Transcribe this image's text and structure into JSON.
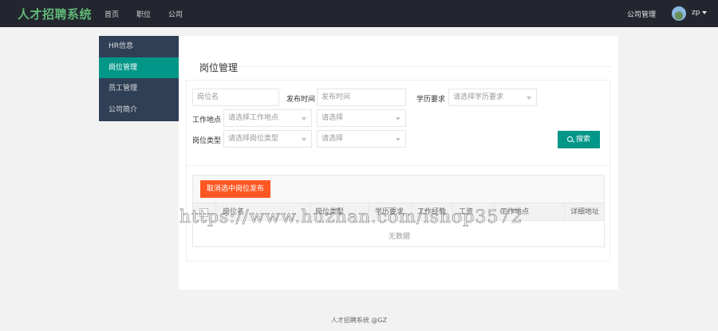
{
  "topbar": {
    "logo": "人才招聘系统",
    "nav": [
      "首页",
      "职位",
      "公司"
    ],
    "right_link": "公司管理",
    "user_name": "zp"
  },
  "sidebar": {
    "items": [
      {
        "label": "HR信息",
        "active": false
      },
      {
        "label": "岗位管理",
        "active": true
      },
      {
        "label": "员工管理",
        "active": false
      },
      {
        "label": "公司简介",
        "active": false
      }
    ]
  },
  "main": {
    "title": "岗位管理",
    "filters": {
      "job_name_placeholder": "岗位名",
      "publish_time_label": "发布时间",
      "publish_time_placeholder": "发布时间",
      "education_label": "学历要求",
      "education_placeholder": "请选择学历要求",
      "location_label": "工作地点",
      "location_placeholder": "请选择工作地点",
      "location_sub_placeholder": "请选择",
      "type_label": "岗位类型",
      "type_placeholder": "请选择岗位类型",
      "type_sub_placeholder": "请选择",
      "search_button": "搜索"
    },
    "table": {
      "cancel_publish_button": "取消选中岗位发布",
      "columns": [
        "岗位名",
        "岗位类型",
        "学历要求",
        "工作经验",
        "工资",
        "工作地点",
        "详细地址"
      ],
      "empty_text": "无数据"
    }
  },
  "watermark": "https://www.huzhan.com/ishop3572",
  "footer": {
    "text": "人才招聘系统 @GZ"
  },
  "colors": {
    "topbar": "#23262e",
    "logo": "#5fb878",
    "sidebar": "#2f4056",
    "accent": "#009688",
    "danger": "#ff5722"
  }
}
